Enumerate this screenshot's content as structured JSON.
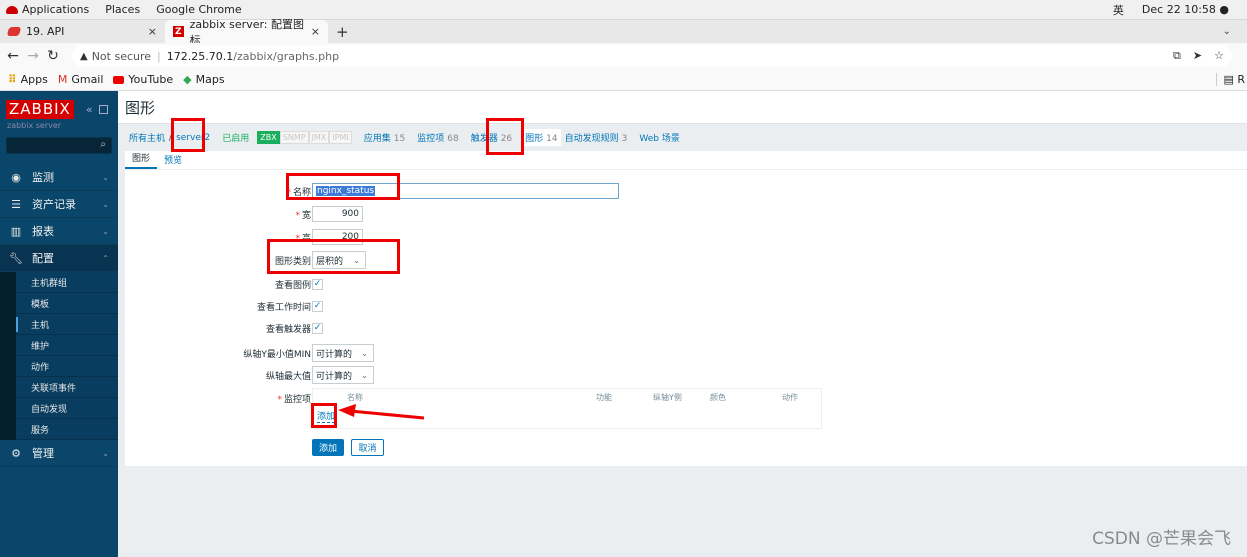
{
  "os_bar": {
    "applications": "Applications",
    "places": "Places",
    "browser": "Google Chrome",
    "ime": "英",
    "datetime": "Dec 22 10:58 ●"
  },
  "browser": {
    "tabs": [
      {
        "title": "19. API",
        "active": false
      },
      {
        "title": "zabbix server: 配置图标",
        "active": true
      }
    ],
    "close_glyph": "×",
    "new_tab": "+",
    "dropdown": "⌄",
    "address": {
      "security": "Not secure",
      "host": "172.25.70.1",
      "path": "/zabbix/graphs.php"
    },
    "bookmarks": [
      {
        "label": "Apps",
        "icon": "apps-grid-icon"
      },
      {
        "label": "Gmail",
        "icon": "gmail-icon"
      },
      {
        "label": "YouTube",
        "icon": "youtube-icon"
      },
      {
        "label": "Maps",
        "icon": "maps-icon"
      }
    ],
    "reading_list": "R"
  },
  "sidebar": {
    "logo": "ZABBIX",
    "server_name": "zabbix server",
    "menu": [
      {
        "label": "监测",
        "icon": "eye-icon"
      },
      {
        "label": "资产记录",
        "icon": "list-icon"
      },
      {
        "label": "报表",
        "icon": "bar-chart-icon"
      },
      {
        "label": "配置",
        "icon": "wrench-icon"
      },
      {
        "label": "管理",
        "icon": "gear-icon"
      }
    ],
    "config_submenu": [
      {
        "label": "主机群组"
      },
      {
        "label": "模板"
      },
      {
        "label": "主机",
        "selected": true
      },
      {
        "label": "维护"
      },
      {
        "label": "动作"
      },
      {
        "label": "关联项事件"
      },
      {
        "label": "自动发现"
      },
      {
        "label": "服务"
      }
    ]
  },
  "page": {
    "title": "图形",
    "breadcrumb": {
      "all_hosts": "所有主机",
      "separator": "/",
      "host": "server2",
      "status": "已启用",
      "badges": [
        {
          "label": "ZBX",
          "active": true
        },
        {
          "label": "SNMP",
          "active": false
        },
        {
          "label": "JMX",
          "active": false
        },
        {
          "label": "IPMI",
          "active": false
        }
      ],
      "links": [
        {
          "label": "应用集",
          "count": "15"
        },
        {
          "label": "监控项",
          "count": "68"
        },
        {
          "label": "触发器",
          "count": "26"
        },
        {
          "label": "图形",
          "count": "14",
          "current": true
        },
        {
          "label": "自动发现规则",
          "count": "3"
        },
        {
          "label": "Web 场景",
          "count": ""
        }
      ]
    },
    "tabs": [
      {
        "label": "图形",
        "active": true
      },
      {
        "label": "预览",
        "active": false
      }
    ],
    "form": {
      "name_label": "名称",
      "name_value": "nginx_status",
      "width_label": "宽",
      "width_value": "900",
      "height_label": "高",
      "height_value": "200",
      "graph_type_label": "图形类别",
      "graph_type_value": "层积的",
      "show_legend_label": "查看图例",
      "show_legend": true,
      "show_worktime_label": "查看工作时间",
      "show_worktime": true,
      "show_triggers_label": "查看触发器",
      "show_triggers": true,
      "ymin_label": "纵轴Y最小值MIN",
      "ymin_value": "可计算的",
      "ymax_label": "纵轴最大值",
      "ymax_value": "可计算的",
      "items_label": "监控项",
      "items_columns": [
        "名称",
        "功能",
        "纵轴Y侧",
        "颜色",
        "动作"
      ],
      "add_item_link": "添加",
      "submit_button": "添加",
      "cancel_button": "取消",
      "required_mark": "*",
      "check_glyph": "✓",
      "select_arrow": "⌄"
    }
  },
  "watermark": "CSDN @芒果会飞",
  "colors": {
    "sidebar_bg": "#0a466a",
    "brand_red": "#d40000",
    "link_blue": "#0275b8",
    "enabled_green": "#1aaf5d",
    "annotation_red": "#e00000"
  }
}
